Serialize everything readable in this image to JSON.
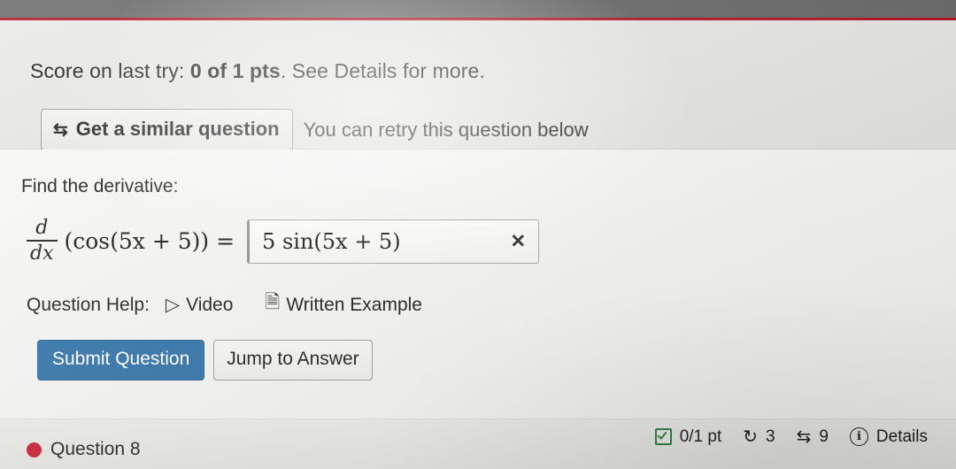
{
  "banner": {
    "score_prefix": "Score on last try: ",
    "score_value": "0 of 1 pts",
    "score_suffix": ". See Details for more.",
    "similar_button_label": "Get a similar question",
    "similar_button_icon": "swap-arrows-icon",
    "retry_text": "You can retry this question below"
  },
  "question": {
    "prompt": "Find the derivative:",
    "derivative_numerator": "d",
    "derivative_denominator": "dx",
    "expression": "(cos(5x + 5)) =",
    "answer_value": "5 sin(5x + 5)",
    "answer_placeholder": "",
    "answer_status_icon": "incorrect-x-icon"
  },
  "help": {
    "label": "Question Help:",
    "video_label": "Video",
    "video_icon": "video-play-icon",
    "written_label": "Written Example",
    "written_icon": "document-icon"
  },
  "actions": {
    "submit_label": "Submit Question",
    "jump_label": "Jump to Answer"
  },
  "footer": {
    "question_label": "Question 8",
    "status_dot": "red-dot-icon",
    "points": "0/1 pt",
    "points_icon": "checkbox-icon",
    "attempts_icon": "retry-arrow-icon",
    "attempts": "3",
    "versions_icon": "swap-arrows-icon",
    "versions": "9",
    "details_icon": "info-icon",
    "details_label": "Details"
  },
  "colors": {
    "accent_red": "#b4172a",
    "submit_blue": "#2c6ea4",
    "green_check": "#2d7a3f"
  }
}
